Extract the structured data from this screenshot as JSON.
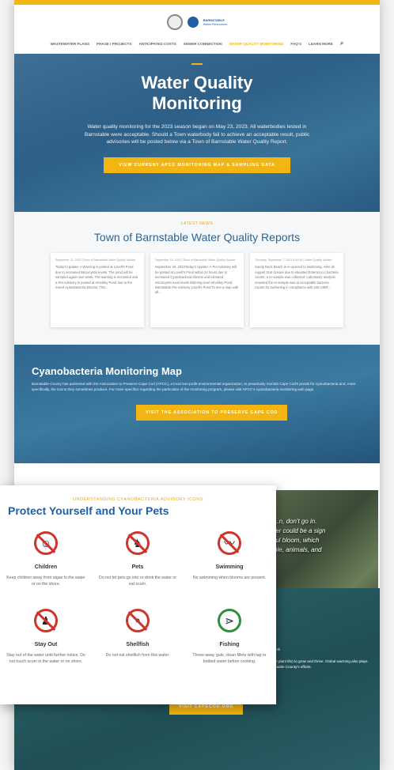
{
  "header": {
    "org_line1": "BARNSTABLE",
    "org_line2": "Water Resources",
    "nav": [
      "WASTEWATER PLANS",
      "PHASE I PROJECTS",
      "ANTICIPATED COSTS",
      "SEWER CONNECTION",
      "WATER QUALITY MONITORING",
      "FAQ's",
      "LEARN MORE"
    ],
    "active_index": 4
  },
  "hero": {
    "title": "Water Quality Monitoring",
    "body": "Water quality monitoring for the 2023 season began on May 23, 2023. All waterbodies tested in Barnstable were acceptable. Should a Town waterbody fail to achieve an acceptable result, public advisories will be posted below via a Town of Barnstable Water Quality Report.",
    "button": "VIEW CURRENT APCC MONITORING MAP & SAMPLING DATA"
  },
  "reports": {
    "kicker": "LATEST NEWS",
    "title": "Town of Barnstable Water Quality Reports",
    "cards": [
      {
        "meta": "September 21, 2023 | Town of Barnstable Water Quality Update",
        "text": "Today's Update:        A Warning is posted at Lovell's Pond due to increased Microcystin levels.  The pond will be sampled again next week.        The warning is increased and a Pet Advisory is posted at Hinckley Pond due to the mixed cyanobacteria blooms.  This..."
      },
      {
        "meta": "September 15, 2023 | Town of Barnstable Water Quality Update",
        "text": "September 29, 2023Today's Update:  A Pet Advisory will be posted at Lovell's Pond within 24 hours due to increased Cyanobacteria blooms and elevated microcystin toxin levels Warning level Hinckley Pond, Barnstable Pet Advisory Lovell's Pond To see a map with all..."
      },
      {
        "meta": "Thursday, September 7, 2023 8:24:46 | Water Quality Update",
        "text": "Sandy Neck Beach is re-opened to swimming.  After its August 31st closure due to elevated Enterococci bacteria counts, a re-sample was collected.  Laboratory analysis revealed the re-sample was at acceptable bacteria counts for swimming in compliance with 105 CMR..."
      }
    ]
  },
  "cyano": {
    "title": "Cyanobacteria Monitoring Map",
    "body": "Barnstable County has partnered with the Association to Preserve Cape Cod (APCC), a local non-profit environmental organization, to proactively monitor Cape Cod's ponds for cyanobacteria and, more specifically, the toxins they sometimes produce. For more specifics regarding the particulars of the monitoring program, please visit APCC's cyanobacteria monitoring web page.",
    "button": "VISIT THE ASSOCIATION TO PRESERVE CAPE COD"
  },
  "photo_caption": "...n, don't go in.\nter could be a sign\nful bloom, which\nple, animals, and",
  "teal": {
    "text_a": "...which is nutrient availability. All",
    "text_b": "dissolved nutrients such as phosphates and nitrogen. The greater the nutrient availability, the more fuel for cyanobacteria (and other undesirable plant life) to grow and thrive. Global warming also plays a key role with warmer pond temperatures favoring cyanobacteria. Learn more about",
    "link": "cyanobacteria monitoring across Cape Cod",
    "text_c": "through Barnstable County's efforts.",
    "button": "VISIT CAPECOD.ORG"
  },
  "pets": {
    "kicker": "UNDERSTANDING CYANOBACTERIA ADVISORY ICONS",
    "title": "Protect Yourself and Your Pets",
    "items": [
      {
        "icon": "children-icon",
        "glyph": "☺",
        "title": "Children",
        "desc": "Keep children away from algae in the water or on the shore."
      },
      {
        "icon": "pets-icon",
        "glyph": "♞",
        "title": "Pets",
        "desc": "Do not let pets go into or drink the water or eat scum."
      },
      {
        "icon": "swimming-icon",
        "glyph": "〰",
        "title": "Swimming",
        "desc": "No swimming when blooms are present."
      },
      {
        "icon": "stay-out-icon",
        "glyph": "♟",
        "title": "Stay Out",
        "desc": "Stay out of the water until further notice. Do not touch scum in the water or on shore."
      },
      {
        "icon": "shellfish-icon",
        "glyph": "⚬",
        "title": "Shellfish",
        "desc": "Do not eat shellfish from this water."
      },
      {
        "icon": "fishing-icon",
        "glyph": "⋗",
        "title": "Fishing",
        "desc": "Throw away guts, clean fillets with tap or bottled water before cooking."
      }
    ]
  },
  "colors": {
    "accent": "#f2b511",
    "blue": "#1f5fa8",
    "warning": "#d0342c"
  }
}
